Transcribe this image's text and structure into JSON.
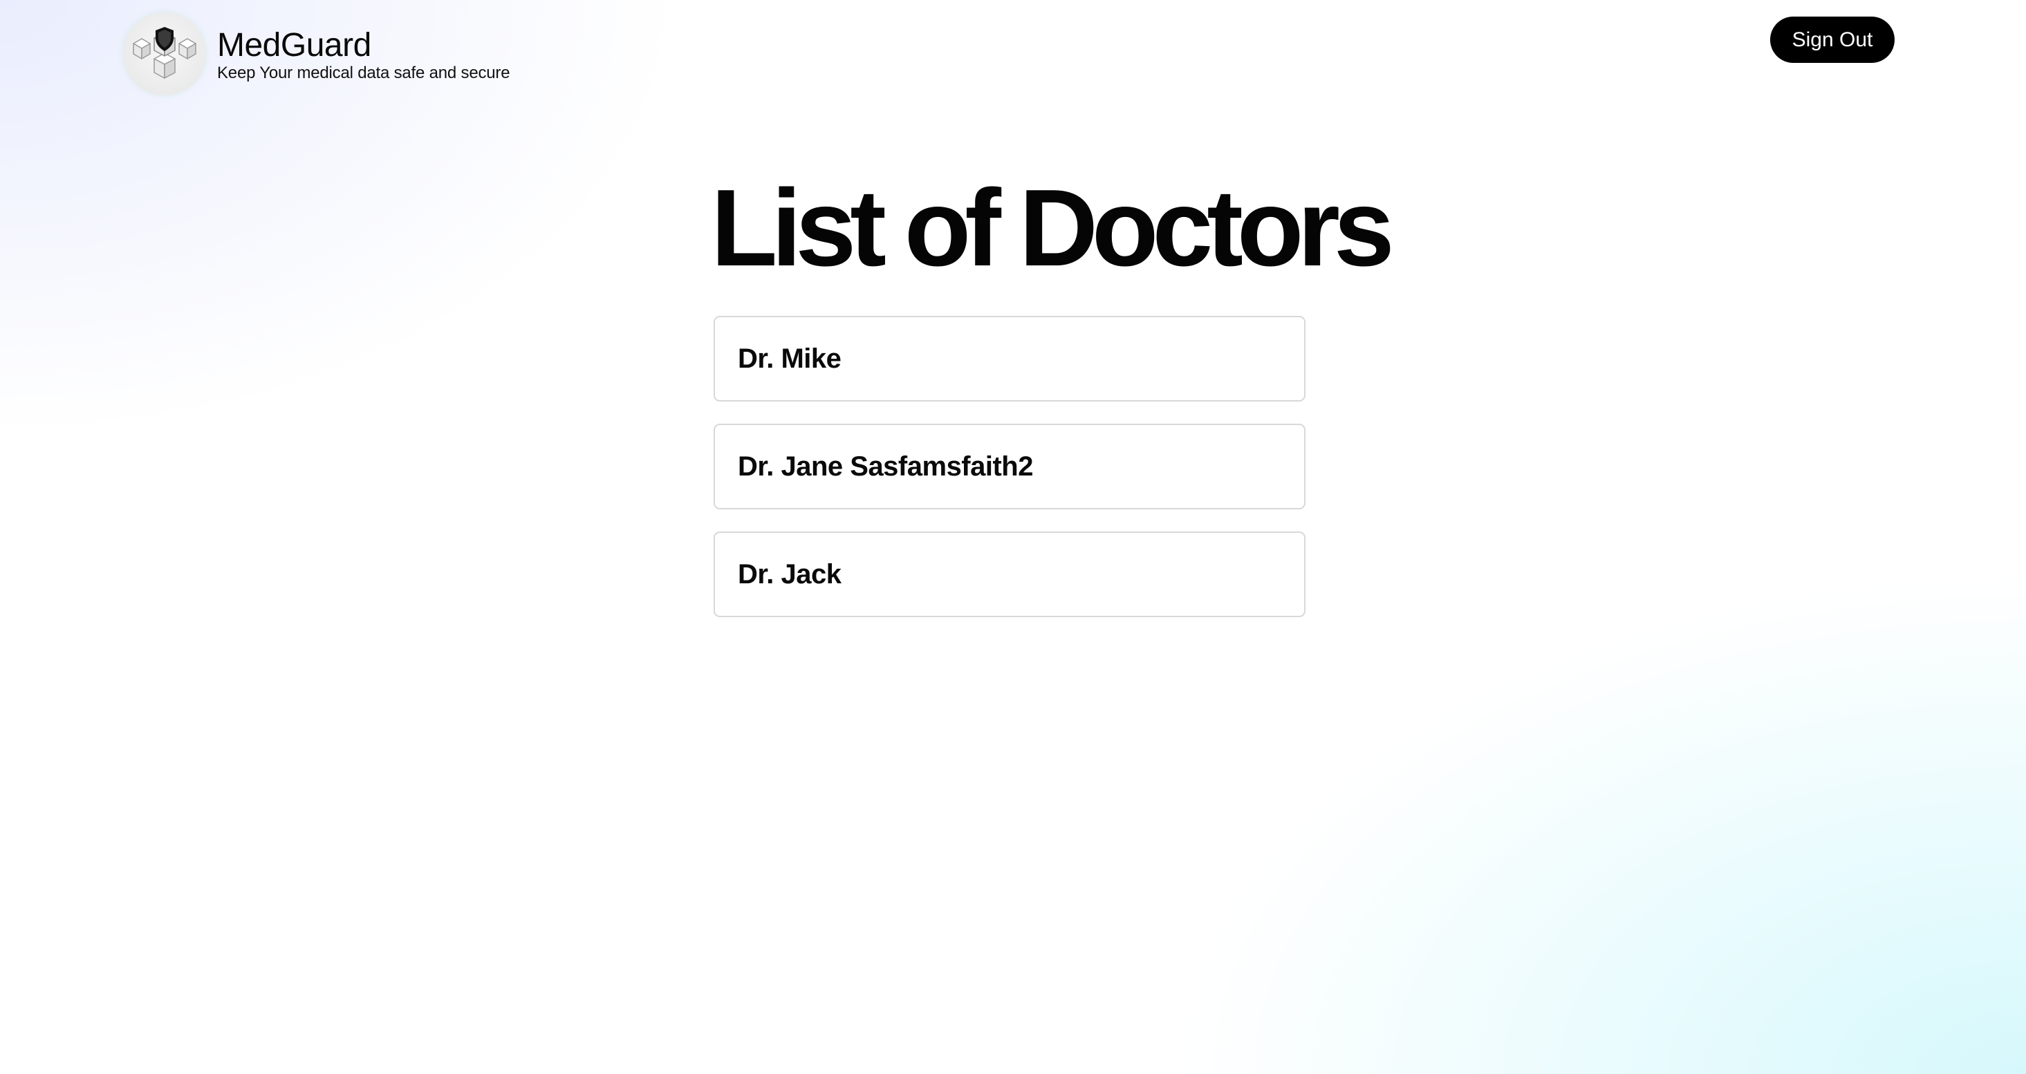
{
  "header": {
    "brand_name": "MedGuard",
    "tagline": "Keep Your medical data safe and secure",
    "logo_icon": "shield-cubes-icon",
    "signout_label": "Sign Out"
  },
  "main": {
    "title": "List of Doctors",
    "doctors": [
      {
        "name": "Dr. Mike"
      },
      {
        "name": "Dr. Jane Sasfamsfaith2"
      },
      {
        "name": "Dr. Jack"
      }
    ]
  },
  "colors": {
    "button_bg": "#000000",
    "button_text": "#ffffff",
    "card_border": "#d8d8d8",
    "bg_top_left": "#e8ecfd",
    "bg_bottom_right": "#d6f8fc"
  }
}
